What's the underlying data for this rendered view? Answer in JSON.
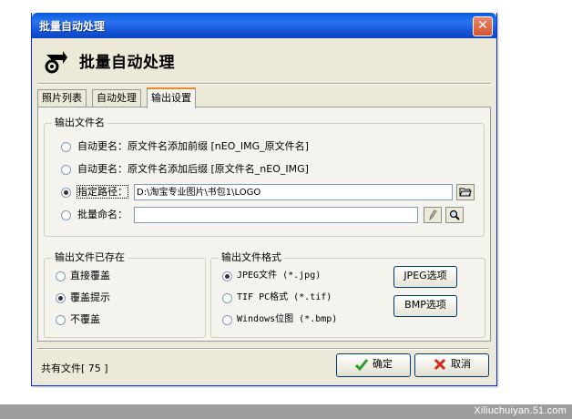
{
  "window": {
    "title": "批量自动处理",
    "close_glyph": "✕"
  },
  "header": {
    "title": "批量自动处理",
    "icon": "gear-arrow-icon"
  },
  "tabs": [
    {
      "label": "照片列表",
      "active": false
    },
    {
      "label": "自动处理",
      "active": false
    },
    {
      "label": "输出设置",
      "active": true
    }
  ],
  "output_name": {
    "title": "输出文件名",
    "options": [
      {
        "label": "自动更名：原文件名添加前缀 [nEO_IMG_原文件名]",
        "checked": false
      },
      {
        "label": "自动更名：原文件名添加后缀 [原文件名_nEO_IMG]",
        "checked": false
      },
      {
        "label": "指定路径：",
        "checked": true,
        "value": "D:\\淘宝专业图片\\书包1\\LOGO"
      },
      {
        "label": "批量命名：",
        "checked": false,
        "value": ""
      }
    ]
  },
  "exists": {
    "title": "输出文件已存在",
    "options": [
      {
        "label": "直接覆盖",
        "checked": false
      },
      {
        "label": "覆盖提示",
        "checked": true
      },
      {
        "label": "不覆盖",
        "checked": false
      }
    ]
  },
  "format": {
    "title": "输出文件格式",
    "options": [
      {
        "label": "JPEG文件 (*.jpg)",
        "checked": true
      },
      {
        "label": "TIF PC格式 (*.tif)",
        "checked": false
      },
      {
        "label": "Windows位图 (*.bmp)",
        "checked": false
      }
    ],
    "jpeg_button": "JPEG选项",
    "bmp_button": "BMP选项"
  },
  "footer": {
    "count_label": "共有文件[ 75 ]",
    "ok_label": "确定",
    "cancel_label": "取消"
  },
  "watermark": "Xiliuchuiyan.51.com"
}
